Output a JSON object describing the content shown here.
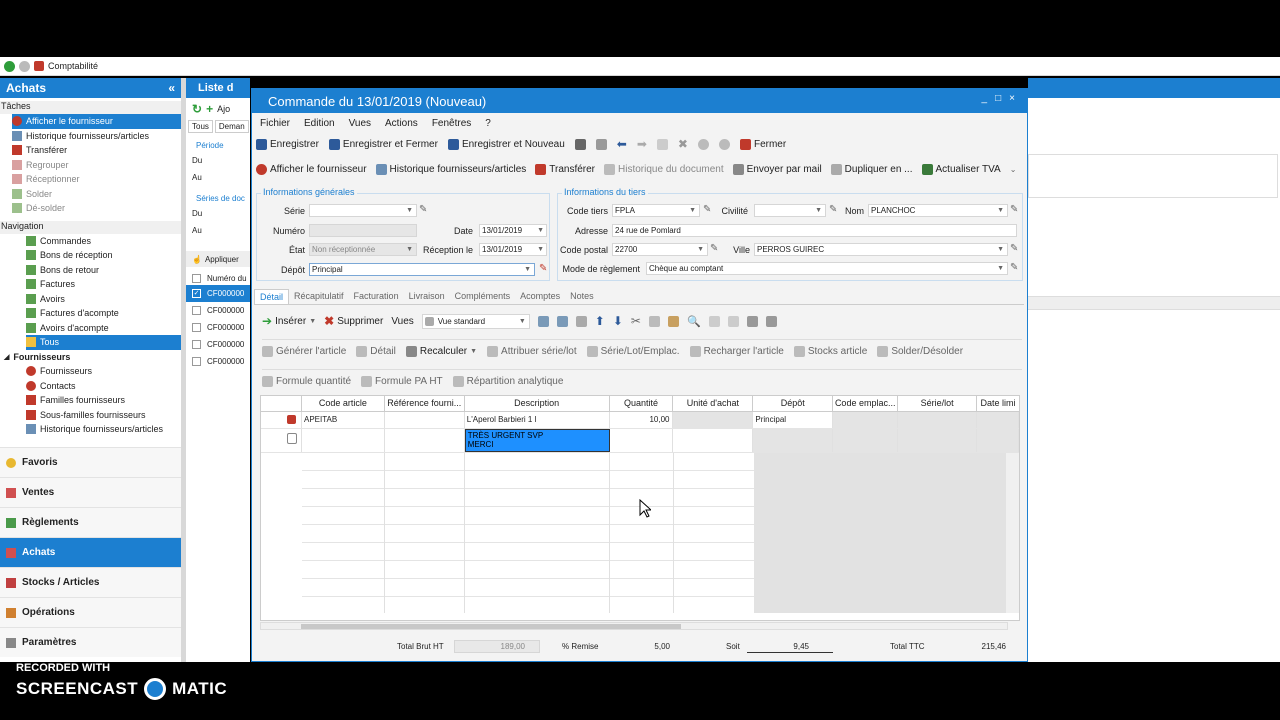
{
  "topbar": {
    "title": "Comptabilité"
  },
  "left": {
    "header": "Achats",
    "collapse": "«",
    "taches_label": "Tâches",
    "taches": [
      {
        "label": "Afficher le fournisseur",
        "selected": true
      },
      {
        "label": "Historique fournisseurs/articles"
      },
      {
        "label": "Transférer"
      },
      {
        "label": "Regrouper",
        "dim": true
      },
      {
        "label": "Réceptionner",
        "dim": true
      },
      {
        "label": "Solder",
        "dim": true
      },
      {
        "label": "Dé-solder",
        "dim": true
      }
    ],
    "navigation_label": "Navigation",
    "nav": [
      {
        "label": "Commandes"
      },
      {
        "label": "Bons de réception"
      },
      {
        "label": "Bons de retour"
      },
      {
        "label": "Factures"
      },
      {
        "label": "Avoirs"
      },
      {
        "label": "Factures d'acompte"
      },
      {
        "label": "Avoirs d'acompte"
      },
      {
        "label": "Tous",
        "selected": true
      }
    ],
    "fournisseurs_label": "Fournisseurs",
    "four": [
      {
        "label": "Fournisseurs"
      },
      {
        "label": "Contacts"
      },
      {
        "label": "Familles fournisseurs"
      },
      {
        "label": "Sous-familles fournisseurs"
      },
      {
        "label": "Historique fournisseurs/articles"
      }
    ],
    "modules": [
      {
        "label": "Favoris"
      },
      {
        "label": "Ventes"
      },
      {
        "label": "Règlements"
      },
      {
        "label": "Achats",
        "active": true
      },
      {
        "label": "Stocks / Articles"
      },
      {
        "label": "Opérations"
      },
      {
        "label": "Paramètres"
      }
    ]
  },
  "mid": {
    "title": "Liste d",
    "ajouter": "Ajo",
    "tabs": [
      "Tous",
      "Deman"
    ],
    "periode": "Période",
    "du": "Du",
    "au": "Au",
    "series": "Séries de doc",
    "du2": "Du",
    "au2": "Au",
    "appliquer": "Appliquer",
    "numero": "Numéro du",
    "rows": [
      "CF000000",
      "CF000000",
      "CF000000",
      "CF000000",
      "CF000000"
    ]
  },
  "dialog": {
    "title": "Commande du 13/01/2019 (Nouveau)",
    "controls": [
      "_",
      "□",
      "×"
    ],
    "menu": [
      "Fichier",
      "Edition",
      "Vues",
      "Actions",
      "Fenêtres",
      "?"
    ],
    "toolbar1": {
      "save": "Enregistrer",
      "save_close": "Enregistrer et Fermer",
      "save_new": "Enregistrer et Nouveau",
      "close": "Fermer"
    },
    "toolbar2": {
      "show_supplier": "Afficher le fournisseur",
      "history": "Historique fournisseurs/articles",
      "transfer": "Transférer",
      "doc_history": "Historique du document",
      "send_mail": "Envoyer par mail",
      "duplicate": "Dupliquer en ...",
      "update_tva": "Actualiser TVA"
    },
    "info_gen": {
      "title": "Informations générales",
      "serie_label": "Série",
      "serie": "",
      "numero_label": "Numéro",
      "numero": "",
      "date_label": "Date",
      "date": "13/01/2019",
      "etat_label": "État",
      "etat": "Non réceptionnée",
      "reception_label": "Réception le",
      "reception": "13/01/2019",
      "depot_label": "Dépôt",
      "depot": "Principal"
    },
    "info_tiers": {
      "title": "Informations du tiers",
      "code_label": "Code tiers",
      "code": "FPLA",
      "civ_label": "Civilité",
      "civ": "",
      "nom_label": "Nom",
      "nom": "PLANCHOC",
      "adr_label": "Adresse",
      "adr": "24 rue de Pomlard",
      "cp_label": "Code postal",
      "cp": "22700",
      "ville_label": "Ville",
      "ville": "PERROS GUIREC",
      "mode_label": "Mode de règlement",
      "mode": "Chèque au comptant"
    },
    "tabs": [
      "Détail",
      "Récapitulatif",
      "Facturation",
      "Livraison",
      "Compléments",
      "Acomptes",
      "Notes"
    ],
    "gridtb1": {
      "insert": "Insérer",
      "delete": "Supprimer",
      "views": "Vues",
      "view_std": "Vue standard"
    },
    "gridtb2": {
      "gen": "Générer l'article",
      "detail": "Détail",
      "recalc": "Recalculer",
      "attr": "Attribuer série/lot",
      "serie": "Série/Lot/Emplac.",
      "reload": "Recharger l'article",
      "stocks": "Stocks article",
      "solder": "Solder/Désolder"
    },
    "gridtb3": {
      "formule_qte": "Formule quantité",
      "formule_pa": "Formule PA HT",
      "repartition": "Répartition analytique"
    },
    "columns": [
      "Code article",
      "Référence fourni...",
      "Description",
      "Quantité",
      "Unité d'achat",
      "Dépôt",
      "Code emplac...",
      "Série/lot",
      "Date limi"
    ],
    "row1": {
      "code": "APEITAB",
      "ref": "",
      "desc": "L'Aperol Barbieri 1 l",
      "qty": "10,00",
      "unit": "",
      "depot": "Principal"
    },
    "row2": {
      "desc1": "TRÈS URGENT SVP",
      "desc2": "MERCI"
    },
    "totals": {
      "brut_label": "Total Brut HT",
      "brut": "189,00",
      "remise_label": "% Remise",
      "remise": "5,00",
      "soit_label": "Soit",
      "soit": "9,45",
      "ttc_label": "Total TTC",
      "ttc": "215,46"
    }
  },
  "recording": {
    "line1": "RECORDED WITH",
    "line2a": "SCREENCAST",
    "line2b": "MATIC"
  }
}
